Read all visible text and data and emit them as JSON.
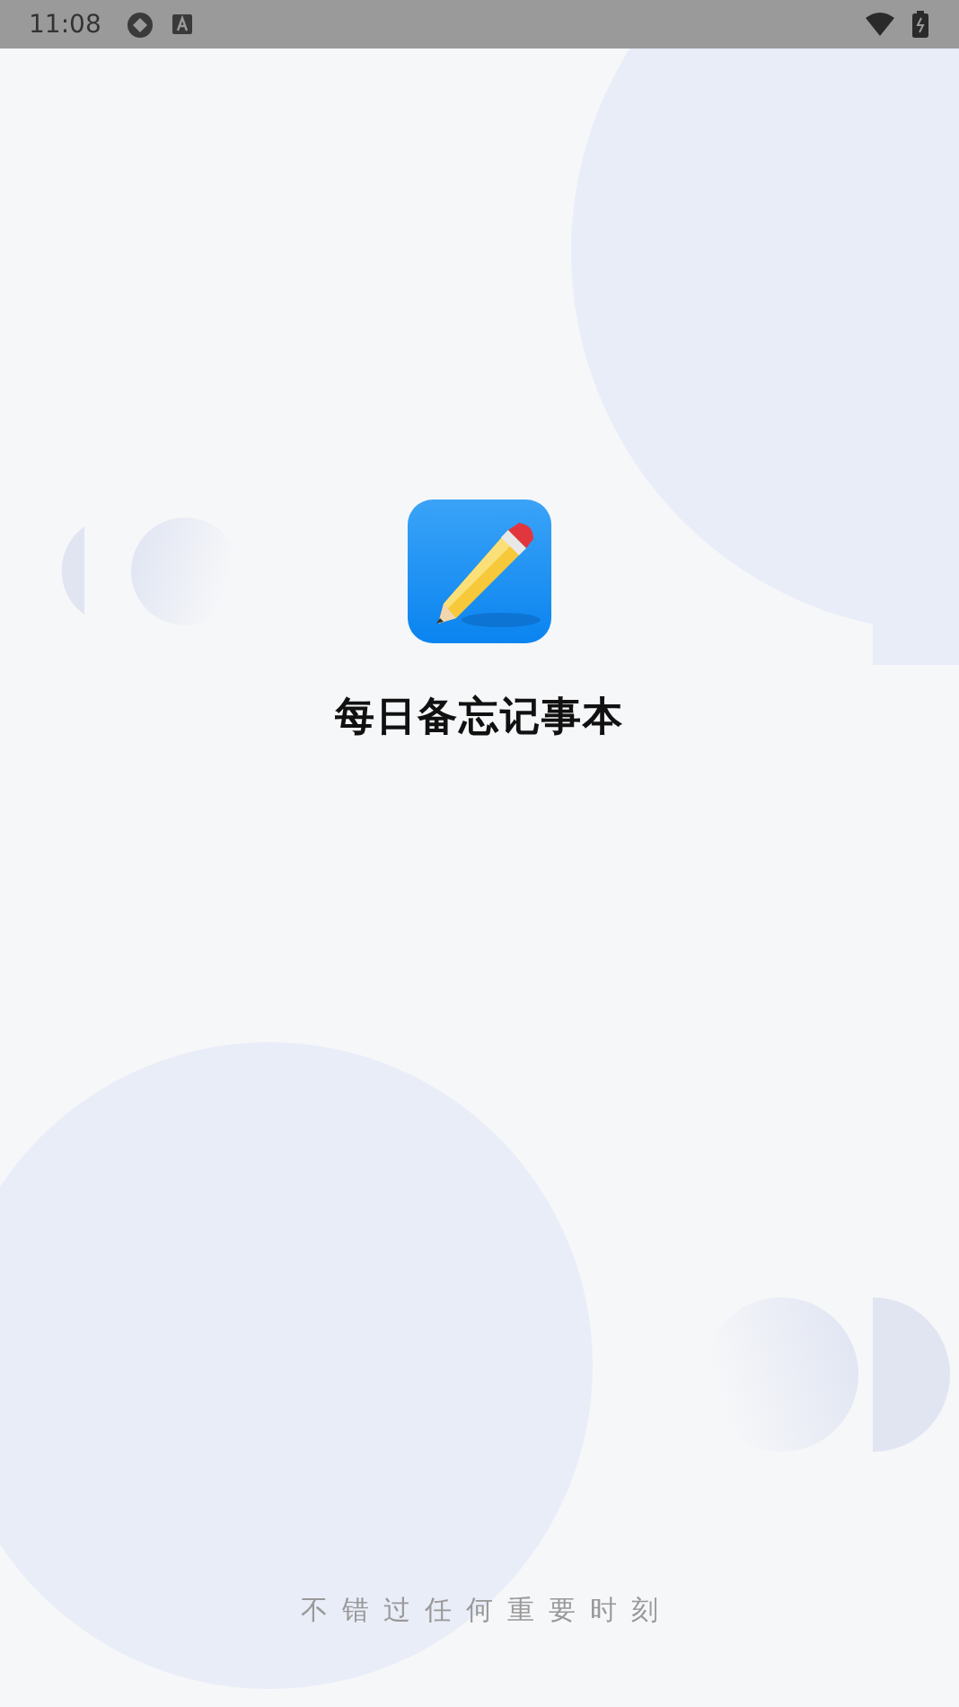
{
  "status_bar": {
    "time": "11:08"
  },
  "app": {
    "name": "每日备忘记事本",
    "slogan": "不错过任何重要时刻"
  }
}
